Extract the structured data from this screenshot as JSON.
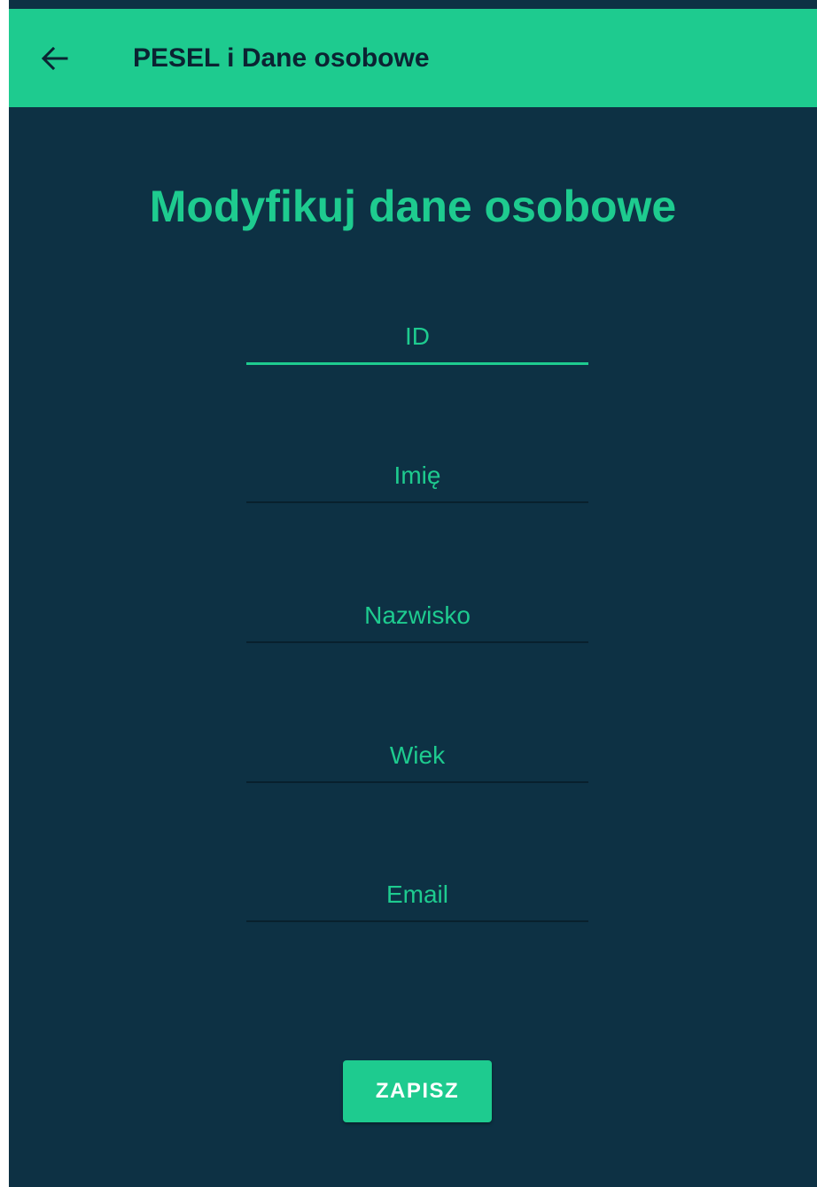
{
  "app_bar": {
    "title": "PESEL i Dane osobowe",
    "back_icon": "arrow-left-icon"
  },
  "form": {
    "heading": "Modyfikuj dane osobowe",
    "fields": [
      {
        "placeholder": "ID",
        "value": ""
      },
      {
        "placeholder": "Imię",
        "value": ""
      },
      {
        "placeholder": "Nazwisko",
        "value": ""
      },
      {
        "placeholder": "Wiek",
        "value": ""
      },
      {
        "placeholder": "Email",
        "value": ""
      }
    ],
    "save_label": "ZAPISZ"
  },
  "colors": {
    "accent": "#1ecb8f",
    "background": "#0d3144",
    "app_bar_text": "#0b2332"
  }
}
